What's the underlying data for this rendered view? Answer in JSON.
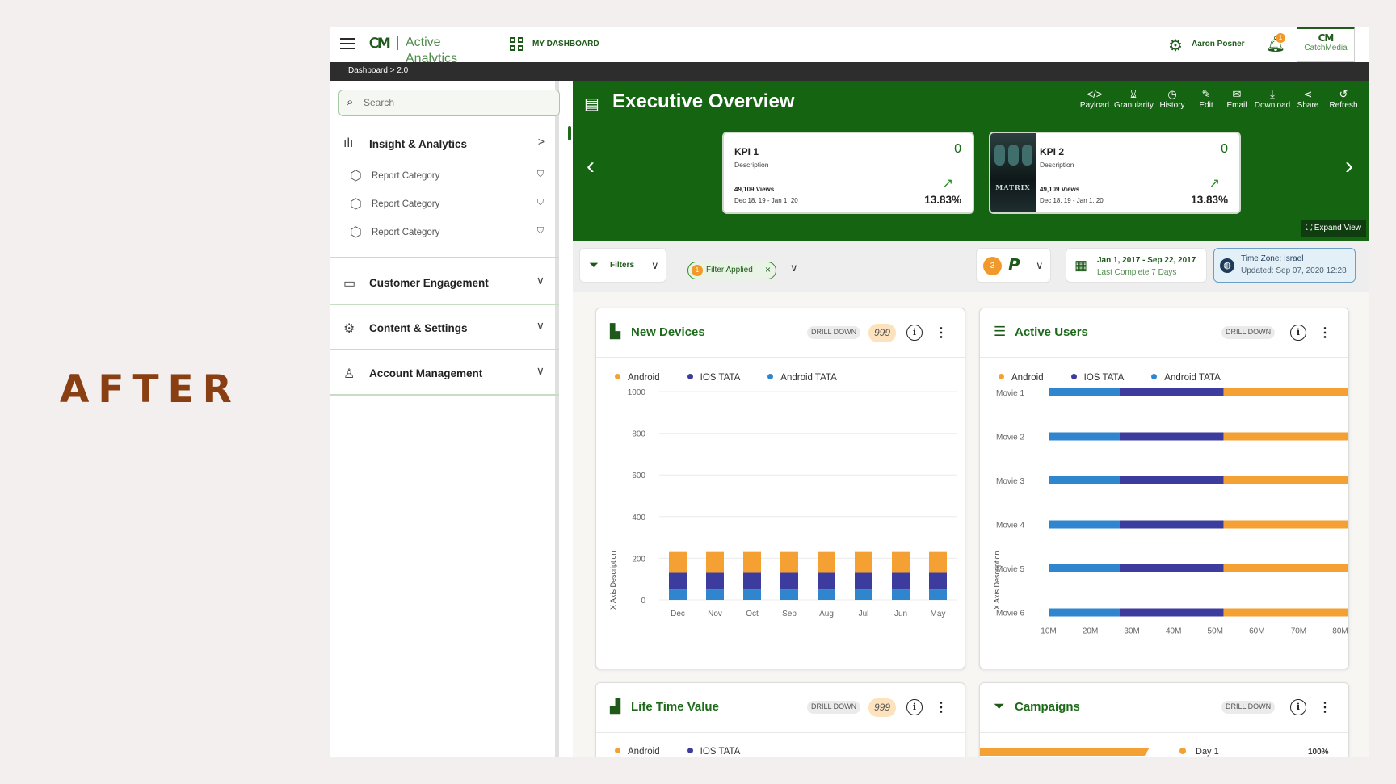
{
  "label": "AFTER",
  "app": {
    "brand": "Active Analytics",
    "nav_dashboard": "MY DASHBOARD",
    "user": "Aaron Posner",
    "notifications": "1",
    "brand_logo_text": "CatchMedia",
    "breadcrumb": "Dashboard > 2.0"
  },
  "sidebar": {
    "search_placeholder": "Search",
    "sections": [
      {
        "label": "Insight & Analytics",
        "icon": "bar-chart-icon",
        "expanded": true
      },
      {
        "label": "Customer Engagement",
        "icon": "chat-icon",
        "expanded": false
      },
      {
        "label": "Content & Settings",
        "icon": "gear-icon",
        "expanded": false
      },
      {
        "label": "Account Management",
        "icon": "person-icon",
        "expanded": false
      }
    ],
    "reports": [
      "Report Category",
      "Report Category",
      "Report Category"
    ]
  },
  "hero": {
    "title": "Executive Overview",
    "tools": [
      "Payload",
      "Granularity",
      "History",
      "Edit",
      "Email",
      "Download",
      "Share",
      "Refresh"
    ],
    "expand": "Expand View",
    "kpis": [
      {
        "name": "KPI 1",
        "desc": "Description",
        "value": "0",
        "views": "49,109 Views",
        "range": "Dec 18, 19 - Jan 1, 20",
        "pct": "13.83%"
      },
      {
        "name": "KPI 2",
        "desc": "Description",
        "value": "0",
        "views": "49,109 Views",
        "range": "Dec 18, 19 - Jan 1, 20",
        "pct": "13.83%",
        "poster": "MATRIX"
      }
    ]
  },
  "filters": {
    "label": "Filters",
    "chip_count": "1",
    "chip_label": "Filter Applied",
    "badge": "3",
    "date_range": "Jan 1, 2017 - Sep 22, 2017",
    "date_sub": "Last Complete 7 Days",
    "tz": "Time Zone: Israel",
    "tz_updated": "Updated: Sep 07, 2020 12:28"
  },
  "colors": {
    "android": "#f5a033",
    "ios": "#3b3c9e",
    "android_tata": "#2f86cf",
    "brand": "#146412"
  },
  "cards": {
    "new_devices": {
      "title": "New Devices",
      "drill": "DRILL DOWN",
      "badge": "999",
      "ytitle": "X Axis Description"
    },
    "active_users": {
      "title": "Active Users",
      "drill": "DRILL DOWN",
      "ytitle": "X Axis Description"
    },
    "ltv": {
      "title": "Life Time Value",
      "drill": "DRILL DOWN",
      "badge": "999"
    },
    "campaigns": {
      "title": "Campaigns",
      "drill": "DRILL DOWN",
      "legend": "Day 1",
      "pct": "100%"
    }
  },
  "legend": [
    "Android",
    "IOS TATA",
    "Android TATA"
  ],
  "chart_data": [
    {
      "type": "bar",
      "title": "New Devices",
      "ylabel": "X Axis Description",
      "categories": [
        "Dec",
        "Nov",
        "Oct",
        "Sep",
        "Aug",
        "Jul",
        "Jun",
        "May"
      ],
      "yticks": [
        0,
        200,
        400,
        600,
        800,
        1000
      ],
      "ylim": [
        0,
        1000
      ],
      "stacked": true,
      "series": [
        {
          "name": "Android TATA",
          "values": [
            50,
            50,
            50,
            50,
            50,
            50,
            50,
            50
          ]
        },
        {
          "name": "IOS TATA",
          "values": [
            80,
            80,
            80,
            80,
            80,
            80,
            80,
            80
          ]
        },
        {
          "name": "Android",
          "values": [
            100,
            100,
            100,
            100,
            100,
            100,
            100,
            100
          ]
        }
      ]
    },
    {
      "type": "bar",
      "orientation": "horizontal",
      "title": "Active Users",
      "ylabel": "X Axis Description",
      "categories": [
        "Movie 1",
        "Movie 2",
        "Movie 3",
        "Movie 4",
        "Movie 5",
        "Movie 6"
      ],
      "xticks": [
        "10M",
        "20M",
        "30M",
        "40M",
        "50M",
        "60M",
        "70M",
        "80M"
      ],
      "xlim": [
        10,
        80
      ],
      "stacked": true,
      "series": [
        {
          "name": "Android TATA",
          "values": [
            17,
            17,
            17,
            17,
            17,
            17
          ]
        },
        {
          "name": "IOS TATA",
          "values": [
            25,
            25,
            25,
            25,
            25,
            25
          ]
        },
        {
          "name": "Android",
          "values": [
            33,
            33,
            33,
            33,
            33,
            33
          ]
        }
      ]
    }
  ]
}
